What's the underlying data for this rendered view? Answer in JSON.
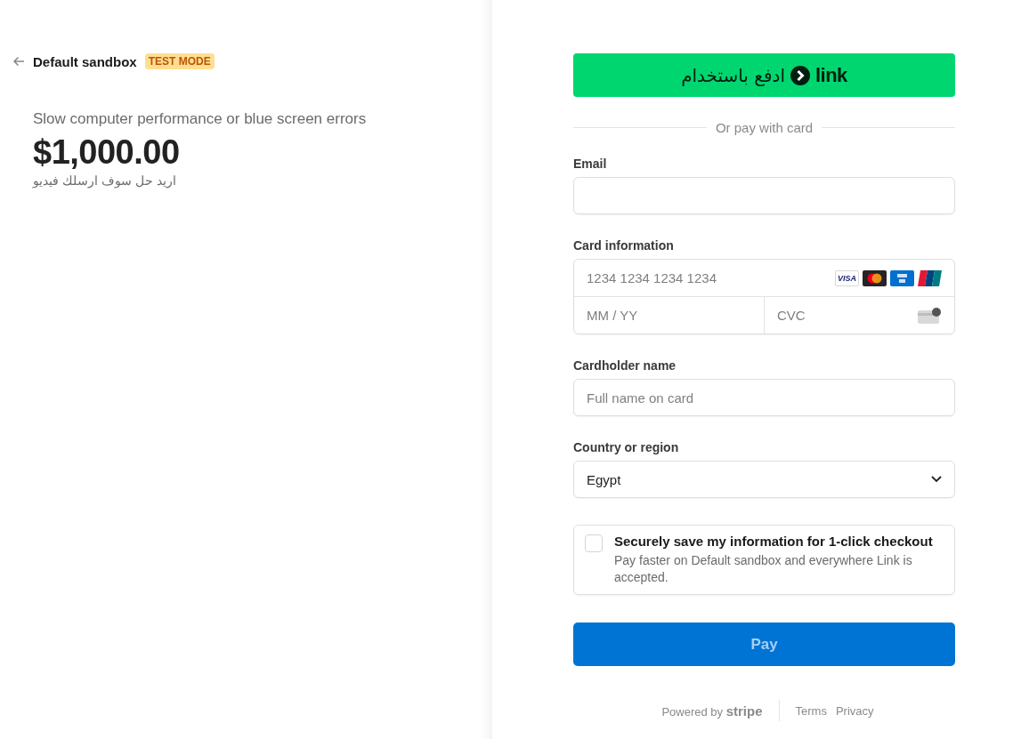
{
  "header": {
    "business": "Default sandbox",
    "badge": "TEST MODE"
  },
  "product": {
    "name": "Slow computer performance or blue screen errors",
    "price": "$1,000.00",
    "description": "اريد حل سوف ارسلك فيديو"
  },
  "link_button": {
    "label": "ادفع باستخدام",
    "logo": "link"
  },
  "divider": "Or pay with card",
  "email": {
    "label": "Email"
  },
  "card": {
    "label": "Card information",
    "number_placeholder": "1234 1234 1234 1234",
    "expiry_placeholder": "MM / YY",
    "cvc_placeholder": "CVC",
    "brands": [
      {
        "kind": "visa",
        "text": "VISA"
      },
      {
        "kind": "mastercard"
      },
      {
        "kind": "amex"
      },
      {
        "kind": "unionpay"
      }
    ]
  },
  "cardholder": {
    "label": "Cardholder name",
    "placeholder": "Full name on card"
  },
  "country": {
    "label": "Country or region",
    "value": "Egypt"
  },
  "save": {
    "checked": false,
    "title": "Securely save my information for 1-click checkout",
    "text": "Pay faster on Default sandbox and everywhere Link is accepted."
  },
  "pay_button": {
    "label": "Pay",
    "disabled": true
  },
  "footer": {
    "powered": "Powered by",
    "brand": "stripe",
    "links": [
      "Terms",
      "Privacy"
    ]
  }
}
